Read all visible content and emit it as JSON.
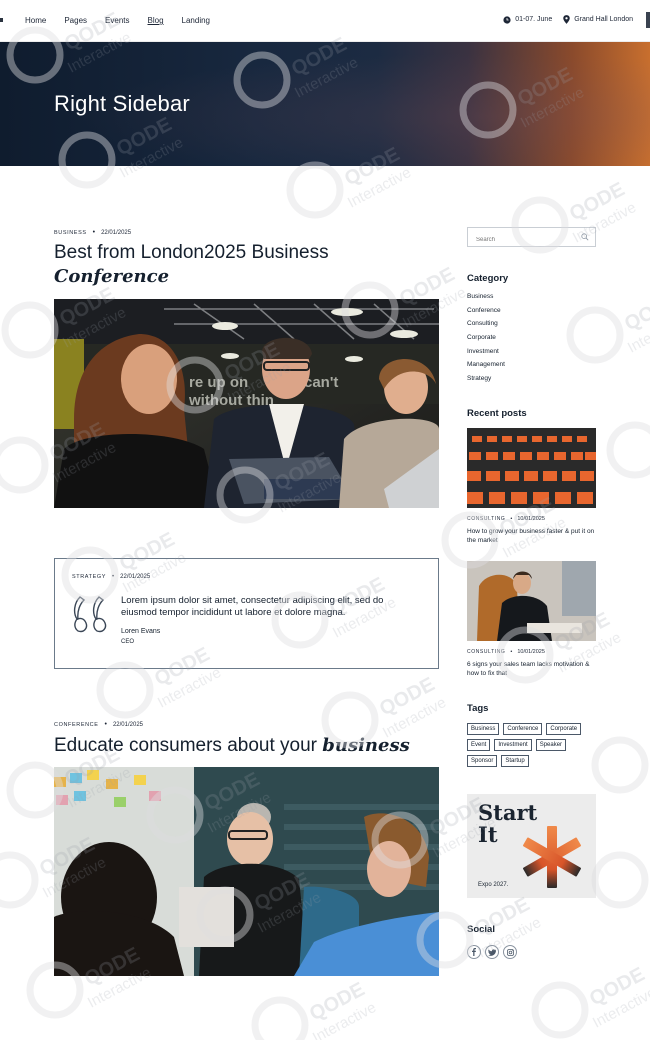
{
  "nav": {
    "items": [
      {
        "label": "Home"
      },
      {
        "label": "Pages"
      },
      {
        "label": "Events"
      },
      {
        "label": "Blog"
      },
      {
        "label": "Landing"
      }
    ],
    "date": "01-07. June",
    "venue": "Grand Hall London"
  },
  "hero": {
    "title": "Right Sidebar"
  },
  "posts": [
    {
      "category": "Business",
      "date": "22/01/2025",
      "title": "Best from London2025 Business",
      "title_em": "Conference"
    },
    {
      "category": "Strategy",
      "date": "22/01/2025",
      "quote": "Lorem ipsum dolor sit amet, consectetur adipiscing elit, sed do eiusmod tempor incididunt ut labore et dolore magna.",
      "author": "Loren Evans",
      "role": "CEO"
    },
    {
      "category": "Conference",
      "date": "22/01/2025",
      "title": "Educate consumers about your",
      "title_em": "business"
    }
  ],
  "sidebar": {
    "search_placeholder": "Search",
    "category_heading": "Category",
    "categories": [
      "Business",
      "Conference",
      "Consulting",
      "Corporate",
      "Investment",
      "Management",
      "Strategy"
    ],
    "recent_heading": "Recent posts",
    "recent": [
      {
        "category": "Consulting",
        "date": "10/01/2025",
        "title": "How to grow your business faster & put it on the market"
      },
      {
        "category": "Consulting",
        "date": "10/01/2025",
        "title": "6 signs your sales team lacks motivation & how to fix that"
      }
    ],
    "tags_heading": "Tags",
    "tags": [
      "Business",
      "Conference",
      "Corporate",
      "Event",
      "Investment",
      "Speaker",
      "Sponsor",
      "Startup"
    ],
    "banner": {
      "line1": "Start",
      "line2": "It",
      "caption": "Expo 2027."
    },
    "social_heading": "Social",
    "social": [
      "facebook-icon",
      "twitter-icon",
      "instagram-icon"
    ]
  },
  "watermark": {
    "brand": "QODE",
    "sub": "Interactive"
  },
  "colors": {
    "accent": "#e8662e",
    "dark": "#15202e",
    "hero_left": "#0f1c2e",
    "hero_right": "#c86f2e"
  }
}
